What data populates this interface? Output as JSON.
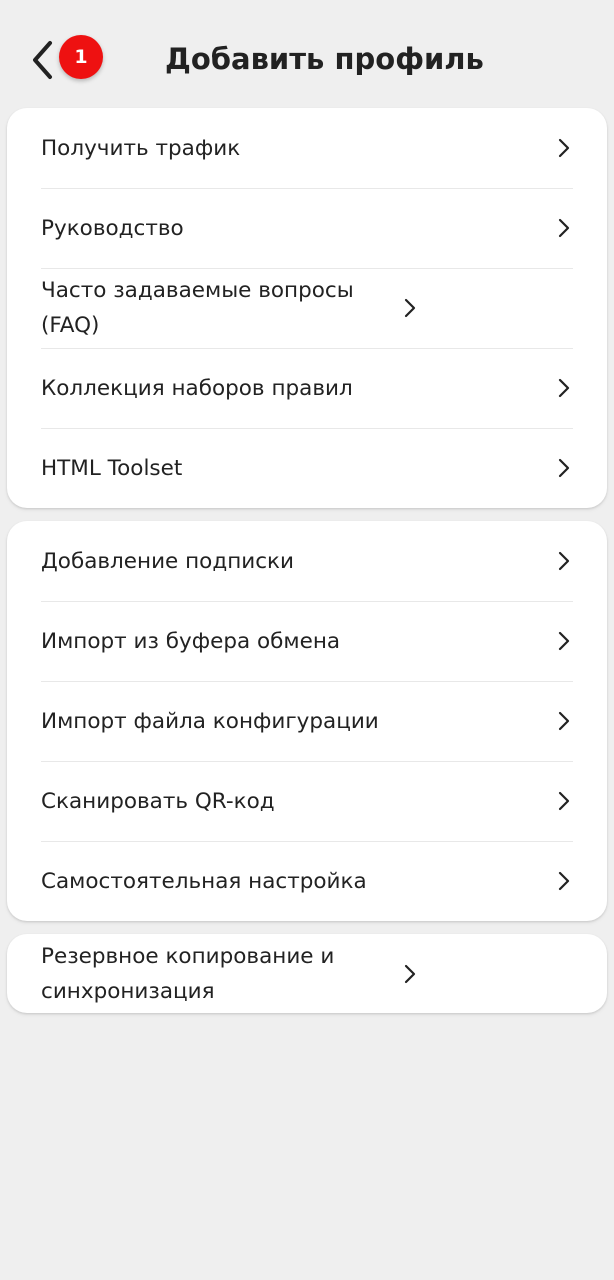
{
  "header": {
    "title": "Добавить профиль",
    "badge_count": "1"
  },
  "colors": {
    "background": "#efefef",
    "card": "#ffffff",
    "badge": "#ee1111",
    "text": "#222222"
  },
  "sections": [
    {
      "items": [
        {
          "label": "Получить трафик",
          "icon": "chevron-right-icon"
        },
        {
          "label": "Руководство",
          "icon": "chevron-right-icon"
        },
        {
          "label": "Часто задаваемые вопросы (FAQ)",
          "icon": "chevron-right-icon"
        },
        {
          "label": "Коллекция наборов правил",
          "icon": "chevron-right-icon"
        },
        {
          "label": "HTML Toolset",
          "icon": "chevron-right-icon"
        }
      ]
    },
    {
      "items": [
        {
          "label": "Добавление подписки",
          "icon": "chevron-right-icon"
        },
        {
          "label": "Импорт из буфера обмена",
          "icon": "chevron-right-icon"
        },
        {
          "label": "Импорт файла конфигурации",
          "icon": "chevron-right-icon"
        },
        {
          "label": "Сканировать QR-код",
          "icon": "chevron-right-icon"
        },
        {
          "label": "Самостоятельная настройка",
          "icon": "chevron-right-icon"
        }
      ]
    },
    {
      "items": [
        {
          "label": "Резервное копирование и синхронизация",
          "icon": "chevron-right-icon"
        }
      ]
    }
  ]
}
